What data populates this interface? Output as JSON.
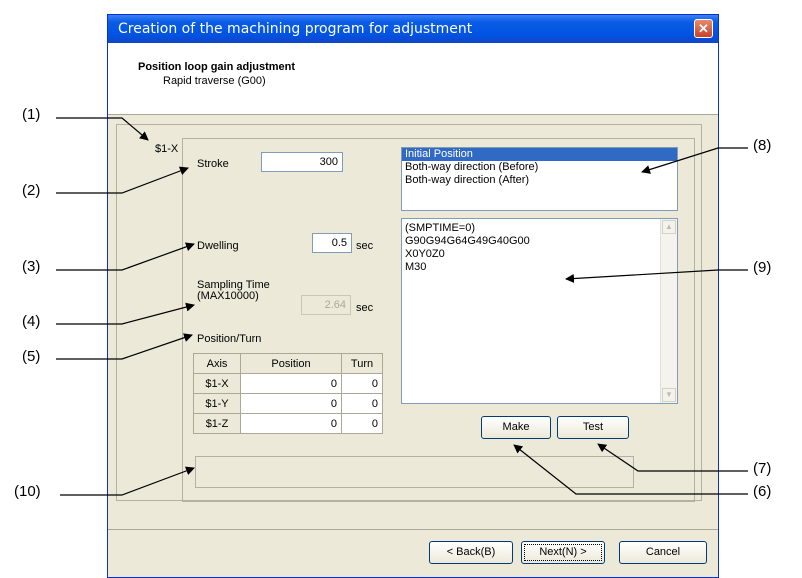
{
  "dialog": {
    "title": "Creation of the machining program for adjustment",
    "close_glyph": "✕",
    "header_title": "Position loop gain adjustment",
    "header_subtitle": "Rapid traverse (G00)",
    "axis_label": "$1-X"
  },
  "form": {
    "stroke_label": "Stroke",
    "stroke_value": "300",
    "dwelling_label": "Dwelling",
    "dwelling_value": "0.5",
    "dwelling_unit": "sec",
    "sampling_label_1": "Sampling Time",
    "sampling_label_2": "(MAX10000)",
    "sampling_value": "2.64",
    "sampling_unit": "sec",
    "position_turn_label": "Position/Turn"
  },
  "table": {
    "headers": [
      "Axis",
      "Position",
      "Turn"
    ],
    "rows": [
      {
        "axis": "$1-X",
        "position": "0",
        "turn": "0"
      },
      {
        "axis": "$1-Y",
        "position": "0",
        "turn": "0"
      },
      {
        "axis": "$1-Z",
        "position": "0",
        "turn": "0"
      }
    ]
  },
  "list": {
    "items": [
      "Initial Position",
      "Both-way direction (Before)",
      "Both-way direction (After)"
    ],
    "selected": "Initial Position"
  },
  "program": {
    "lines": [
      "(SMPTIME=0)",
      "G90G94G64G49G40G00",
      "X0Y0Z0",
      "M30"
    ]
  },
  "buttons": {
    "make": "Make",
    "test": "Test",
    "back": "< Back(B)",
    "next": "Next(N) >",
    "cancel": "Cancel"
  },
  "callouts": [
    "(1)",
    "(2)",
    "(3)",
    "(4)",
    "(5)",
    "(6)",
    "(7)",
    "(8)",
    "(9)",
    "(10)"
  ]
}
